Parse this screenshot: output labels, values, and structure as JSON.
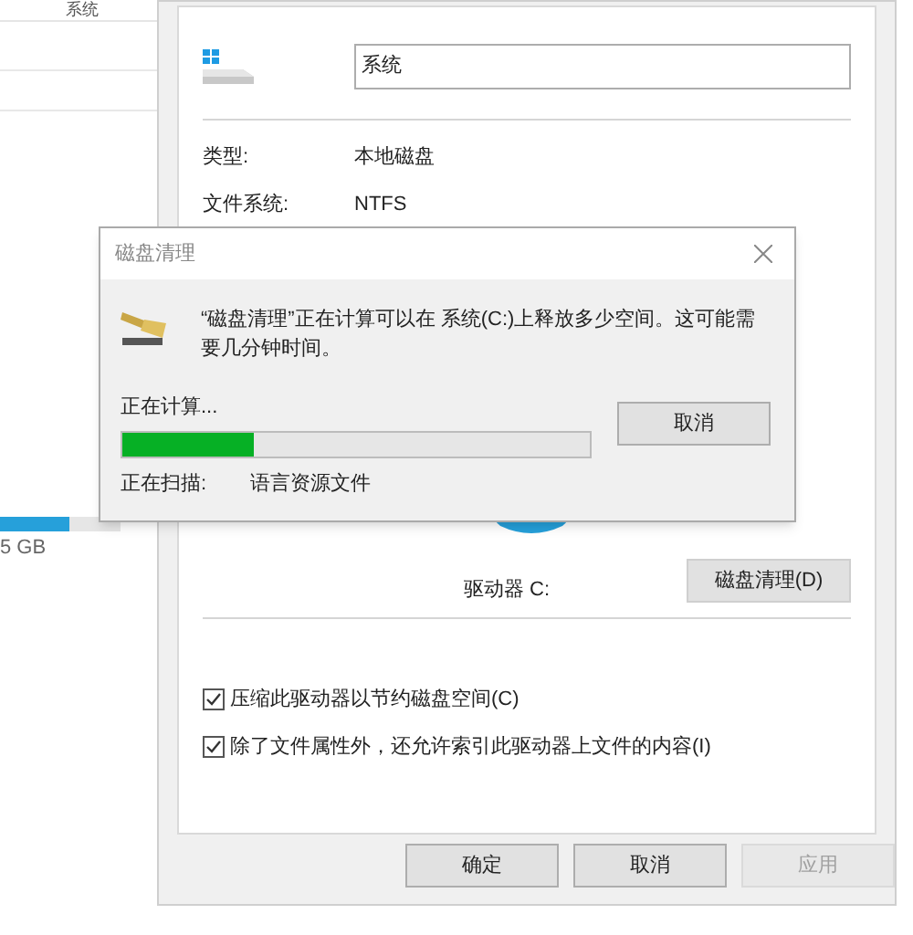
{
  "background_window": {
    "column_header": "系统",
    "drive_bar": {
      "level": 0.58
    },
    "size_text": "5 GB"
  },
  "properties": {
    "name_value": "系统",
    "info": [
      {
        "label": "类型:",
        "value": "本地磁盘"
      },
      {
        "label": "文件系统:",
        "value": "NTFS"
      }
    ],
    "drive_label": "驱动器 C:",
    "cleanup_button": "磁盘清理(D)",
    "options": [
      {
        "label": "压缩此驱动器以节约磁盘空间(C)",
        "checked": true
      },
      {
        "label": "除了文件属性外，还允许索引此驱动器上文件的内容(I)",
        "checked": true
      }
    ],
    "buttons": [
      {
        "label": "确定",
        "disabled": false
      },
      {
        "label": "取消",
        "disabled": false
      },
      {
        "label": "应用",
        "disabled": true
      }
    ]
  },
  "cleanup_dialog": {
    "title": "磁盘清理",
    "message": "“磁盘清理”正在计算可以在 系统(C:)上释放多少空间。这可能需要几分钟时间。",
    "status": "正在计算...",
    "level": 0.28,
    "cancel": "取消",
    "scan_label": "正在扫描:",
    "scan_item": "语言资源文件"
  }
}
